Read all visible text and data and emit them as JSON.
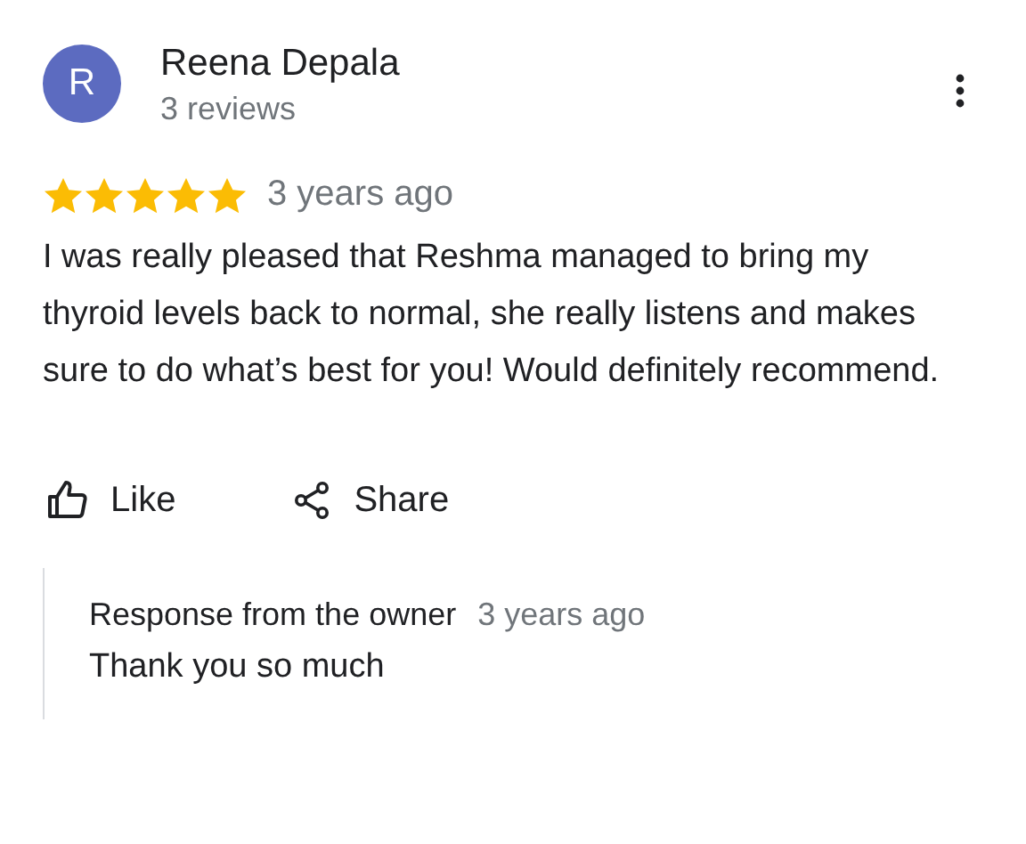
{
  "reviewer": {
    "initial": "R",
    "name": "Reena Depala",
    "meta": "3 reviews"
  },
  "rating": {
    "stars": 5
  },
  "time": "3 years ago",
  "text": "I was really pleased that Reshma managed to bring my thyroid levels back to normal, she really listens and makes sure to do what’s best for you! Would definitely recommend.",
  "actions": [
    {
      "kind": "like",
      "label": "Like"
    },
    {
      "kind": "share",
      "label": "Share"
    }
  ],
  "response": {
    "title": "Response from the owner",
    "time": "3 years ago",
    "text": "Thank you so much"
  }
}
